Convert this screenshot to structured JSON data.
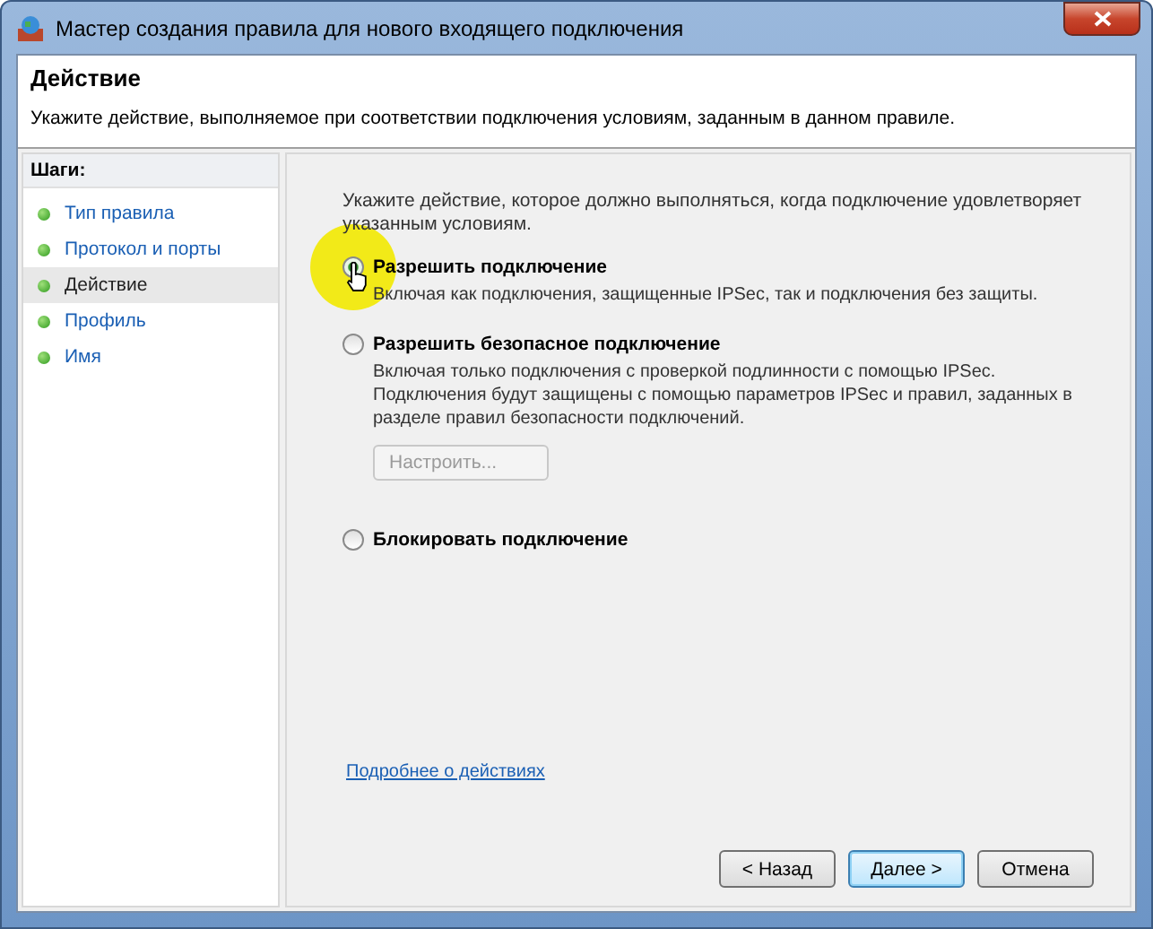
{
  "window": {
    "title": "Мастер создания правила для нового входящего подключения"
  },
  "header": {
    "title": "Действие",
    "subtitle": "Укажите действие, выполняемое при соответствии подключения условиям, заданным в данном правиле."
  },
  "steps_label": "Шаги:",
  "steps": [
    {
      "label": "Тип правила",
      "selected": false
    },
    {
      "label": "Протокол и порты",
      "selected": false
    },
    {
      "label": "Действие",
      "selected": true
    },
    {
      "label": "Профиль",
      "selected": false
    },
    {
      "label": "Имя",
      "selected": false
    }
  ],
  "prompt": "Укажите действие, которое должно выполняться, когда подключение удовлетворяет указанным условиям.",
  "options": [
    {
      "label": "Разрешить подключение",
      "selected": true,
      "description": "Включая как подключения, защищенные IPSec, так и подключения без защиты."
    },
    {
      "label": "Разрешить безопасное подключение",
      "selected": false,
      "description": "Включая только подключения с проверкой подлинности с помощью IPSec. Подключения будут защищены с помощью параметров IPSec и правил, заданных в разделе правил безопасности подключений.",
      "button": {
        "label": "Настроить...",
        "disabled": true
      }
    },
    {
      "label": "Блокировать подключение",
      "selected": false
    }
  ],
  "help_link": "Подробнее о действиях",
  "buttons": [
    {
      "label": "< Назад",
      "default": false
    },
    {
      "label": "Далее >",
      "default": true
    },
    {
      "label": "Отмена",
      "default": false
    }
  ]
}
